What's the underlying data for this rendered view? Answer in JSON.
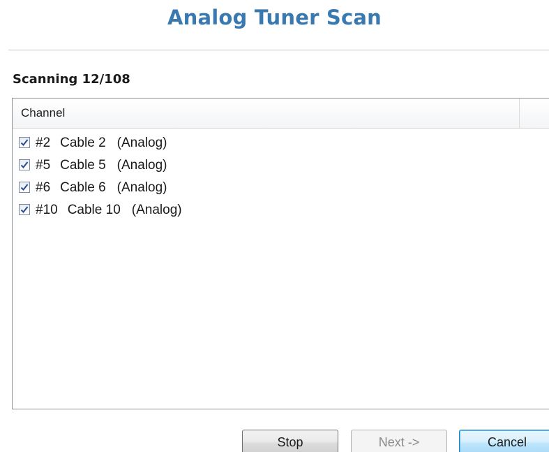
{
  "window": {
    "title": "Analog Tuner Scan"
  },
  "status": {
    "text": "Scanning 12/108"
  },
  "listview": {
    "columns": [
      "Channel"
    ],
    "rows": [
      {
        "checked": true,
        "number": "#2",
        "name": "Cable 2",
        "type": "(Analog)"
      },
      {
        "checked": true,
        "number": "#5",
        "name": "Cable 5",
        "type": "(Analog)"
      },
      {
        "checked": true,
        "number": "#6",
        "name": "Cable 6",
        "type": "(Analog)"
      },
      {
        "checked": true,
        "number": "#10",
        "name": "Cable 10",
        "type": "(Analog)"
      }
    ]
  },
  "buttons": {
    "stop_label": "Stop",
    "next_label": "Next ->",
    "cancel_label": "Cancel"
  },
  "colors": {
    "title": "#3a78b0",
    "checkmark": "#2a4a8a"
  },
  "icons": {
    "checkbox": "checkbox-checked-icon"
  }
}
